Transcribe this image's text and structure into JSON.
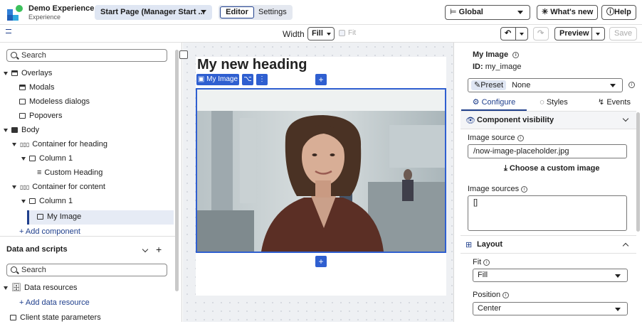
{
  "app": {
    "name": "Demo Experience",
    "subtitle": "Experience"
  },
  "header": {
    "page_select": "Start Page (Manager Start ...",
    "mode_tabs": {
      "editor": "Editor",
      "settings": "Settings"
    },
    "scope": "Global",
    "whats_new": "What's new",
    "help": "Help"
  },
  "toolbar": {
    "width_label": "Width",
    "width_value": "Fill",
    "fit_label": "Fit",
    "preview": "Preview",
    "save": "Save"
  },
  "left_panel": {
    "search_placeholder": "Search",
    "tree": {
      "overlays": "Overlays",
      "modals": "Modals",
      "modeless": "Modeless dialogs",
      "popovers": "Popovers",
      "body": "Body",
      "container_heading": "Container for heading",
      "column1a": "Column 1",
      "custom_heading": "Custom Heading",
      "container_content": "Container for content",
      "column1b": "Column 1",
      "my_image": "My Image",
      "add_component": "+ Add component"
    },
    "data_section": {
      "title": "Data and scripts",
      "search_placeholder": "Search",
      "data_resources": "Data resources",
      "add_data_resource": "+ Add data resource",
      "client_state": "Client state parameters"
    }
  },
  "canvas": {
    "heading": "My new heading",
    "chip_label": "My Image",
    "plus": "+"
  },
  "right_panel": {
    "component_name": "My Image",
    "id_label": "ID:",
    "id_value": "my_image",
    "preset_label": "Preset",
    "preset_value": "None",
    "tabs": {
      "configure": "Configure",
      "styles": "Styles",
      "events": "Events"
    },
    "visibility": "Component visibility",
    "image_source_label": "Image source",
    "image_source_value": "/now-image-placeholder.jpg",
    "choose_image": "Choose a custom image",
    "image_sources_label": "Image sources",
    "image_sources_value": "[]",
    "layout": "Layout",
    "fit_label": "Fit",
    "fit_value": "Fill",
    "position_label": "Position",
    "position_value": "Center"
  },
  "colors": {
    "accent": "#1f3f8c",
    "selection": "#2f5fd0"
  }
}
